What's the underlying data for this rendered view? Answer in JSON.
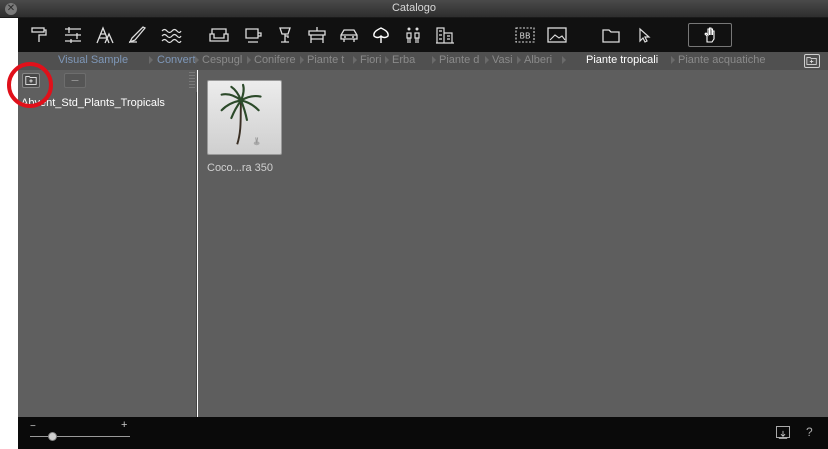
{
  "window": {
    "title": "Catalogo"
  },
  "toolbar": {
    "tools": [
      {
        "icon": "paint-roller-icon"
      },
      {
        "icon": "texture-grid-icon"
      },
      {
        "icon": "stairs-icon"
      },
      {
        "icon": "brush-icon"
      },
      {
        "icon": "water-waves-icon"
      },
      {
        "icon": "sofa-icon"
      },
      {
        "icon": "bathtub-icon"
      },
      {
        "icon": "lamp-icon"
      },
      {
        "icon": "table-icon"
      },
      {
        "icon": "car-icon"
      },
      {
        "icon": "plant-icon"
      },
      {
        "icon": "people-icon"
      },
      {
        "icon": "building-icon"
      },
      {
        "icon": "billboard-icon"
      },
      {
        "icon": "image-icon"
      },
      {
        "icon": "folder-icon"
      },
      {
        "icon": "cursor-icon"
      },
      {
        "icon": "hand-icon"
      }
    ]
  },
  "breadcrumbs": [
    {
      "label": "Visual Sample",
      "style": "blue"
    },
    {
      "label": "Convert",
      "style": "blue"
    },
    {
      "label": "Cespugl",
      "style": "normal"
    },
    {
      "label": "Conifere",
      "style": "normal"
    },
    {
      "label": "Piante t",
      "style": "normal"
    },
    {
      "label": "Fiori",
      "style": "normal"
    },
    {
      "label": "Erba",
      "style": "normal"
    },
    {
      "label": "Piante d",
      "style": "normal"
    },
    {
      "label": "Vasi",
      "style": "normal"
    },
    {
      "label": "Alberi",
      "style": "normal"
    },
    {
      "label": "Piante tropicali",
      "style": "current"
    },
    {
      "label": "Piante acquatiche",
      "style": "normal"
    }
  ],
  "left_panel": {
    "folders": [
      "Abvent_Std_Plants_Tropicals"
    ]
  },
  "content": {
    "items": [
      {
        "label": "Coco...ra 350"
      }
    ]
  },
  "statusbar": {
    "zoom_minus": "−",
    "zoom_plus": "+",
    "help": "?",
    "zoom_level": 0.22
  },
  "colors": {
    "highlight": "#e0101a",
    "breadcrumb_link": "#7e97b8"
  }
}
